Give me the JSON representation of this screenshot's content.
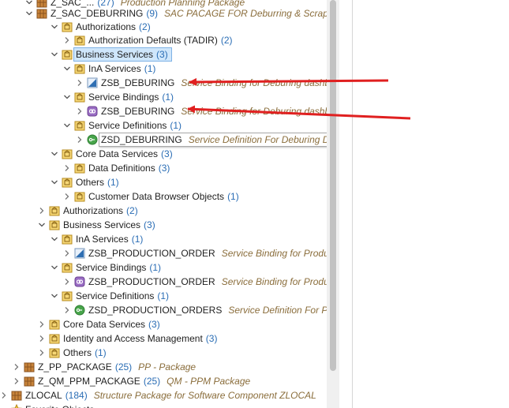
{
  "tree": {
    "rows": [
      {
        "label": "Z_SAC_...",
        "count": "(27)",
        "desc": "Production Planning Package",
        "icon": "package-icon",
        "twisty": "expanded"
      },
      {
        "label": "Z_SAC_DEBURRING",
        "count": "(9)",
        "desc": "SAC PACAGE FOR Deburring & Scrap N",
        "icon": "package-icon",
        "twisty": "expanded"
      },
      {
        "label": "Authorizations",
        "count": "(2)",
        "desc": "",
        "icon": "folder-icon",
        "twisty": "expanded"
      },
      {
        "label": "Authorization Defaults (TADIR)",
        "count": "(2)",
        "desc": "",
        "icon": "folder-icon",
        "twisty": "collapsed"
      },
      {
        "label": "Business Services",
        "count": "(3)",
        "desc": "",
        "icon": "folder-icon",
        "twisty": "expanded"
      },
      {
        "label": "InA Services",
        "count": "(1)",
        "desc": "",
        "icon": "folder-icon",
        "twisty": "expanded"
      },
      {
        "label": "ZSB_DEBURING",
        "count": "",
        "desc": "Service Binding for Deburing dashboo",
        "icon": "ina-service-icon",
        "twisty": "collapsed"
      },
      {
        "label": "Service Bindings",
        "count": "(1)",
        "desc": "",
        "icon": "folder-icon",
        "twisty": "expanded"
      },
      {
        "label": "ZSB_DEBURING",
        "count": "",
        "desc": "Service Binding for Deburing dashboo",
        "icon": "service-binding-icon",
        "twisty": "collapsed"
      },
      {
        "label": "Service Definitions",
        "count": "(1)",
        "desc": "",
        "icon": "folder-icon",
        "twisty": "expanded"
      },
      {
        "label": "ZSD_DEBURRING",
        "count": "",
        "desc": "Service Definition For Deburing Dashboard",
        "icon": "service-definition-icon",
        "twisty": "collapsed"
      },
      {
        "label": "Core Data Services",
        "count": "(3)",
        "desc": "",
        "icon": "folder-icon",
        "twisty": "expanded"
      },
      {
        "label": "Data Definitions",
        "count": "(3)",
        "desc": "",
        "icon": "folder-icon",
        "twisty": "collapsed"
      },
      {
        "label": "Others",
        "count": "(1)",
        "desc": "",
        "icon": "folder-icon",
        "twisty": "expanded"
      },
      {
        "label": "Customer Data Browser Objects",
        "count": "(1)",
        "desc": "",
        "icon": "folder-icon",
        "twisty": "collapsed"
      },
      {
        "label": "Authorizations",
        "count": "(2)",
        "desc": "",
        "icon": "folder-icon",
        "twisty": "collapsed"
      },
      {
        "label": "Business Services",
        "count": "(3)",
        "desc": "",
        "icon": "folder-icon",
        "twisty": "expanded"
      },
      {
        "label": "InA Services",
        "count": "(1)",
        "desc": "",
        "icon": "folder-icon",
        "twisty": "expanded"
      },
      {
        "label": "ZSB_PRODUCTION_ORDER",
        "count": "",
        "desc": "Service Binding for Production",
        "icon": "ina-service-icon",
        "twisty": "collapsed"
      },
      {
        "label": "Service Bindings",
        "count": "(1)",
        "desc": "",
        "icon": "folder-icon",
        "twisty": "expanded"
      },
      {
        "label": "ZSB_PRODUCTION_ORDER",
        "count": "",
        "desc": "Service Binding for Production",
        "icon": "service-binding-icon",
        "twisty": "collapsed"
      },
      {
        "label": "Service Definitions",
        "count": "(1)",
        "desc": "",
        "icon": "folder-icon",
        "twisty": "expanded"
      },
      {
        "label": "ZSD_PRODUCTION_ORDERS",
        "count": "",
        "desc": "Service Definition For Produ",
        "icon": "service-definition-icon",
        "twisty": "collapsed"
      },
      {
        "label": "Core Data Services",
        "count": "(3)",
        "desc": "",
        "icon": "folder-icon",
        "twisty": "collapsed"
      },
      {
        "label": "Identity and Access Management",
        "count": "(3)",
        "desc": "",
        "icon": "folder-icon",
        "twisty": "collapsed"
      },
      {
        "label": "Others",
        "count": "(1)",
        "desc": "",
        "icon": "folder-icon",
        "twisty": "collapsed"
      },
      {
        "label": "Z_PP_PACKAGE",
        "count": "(25)",
        "desc": "PP - Package",
        "icon": "package-icon",
        "twisty": "collapsed"
      },
      {
        "label": "Z_QM_PPM_PACKAGE",
        "count": "(25)",
        "desc": "QM - PPM Package",
        "icon": "package-icon",
        "twisty": "collapsed"
      },
      {
        "label": "ZLOCAL",
        "count": "(184)",
        "desc": "Structure Package for Software Component ZLOCAL",
        "icon": "package-icon",
        "twisty": "collapsed"
      },
      {
        "label": "Favorite Objects",
        "count": "",
        "desc": "",
        "icon": "star-icon",
        "twisty": "none"
      }
    ]
  },
  "colors": {
    "accent": "#2a6db5",
    "description": "#8a6d3b",
    "selection": "#cfe6fb",
    "arrow": "#e02020"
  }
}
